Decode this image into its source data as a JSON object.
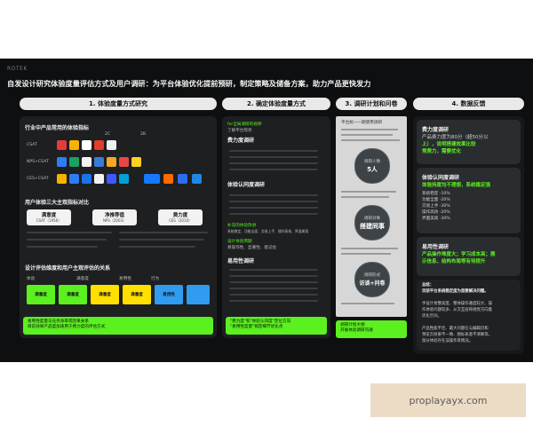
{
  "brand": "ROTEK",
  "title": "自发设计研究体验度量评估方式及用户调研：为平台体验优化提前预研，制定策略及储备方案，助力产品更快发力",
  "sections": [
    {
      "label": "1. 体验度量方式研究"
    },
    {
      "label": "2. 确定体验度量方式"
    },
    {
      "label": "3. 调研计划和问卷"
    },
    {
      "label": "4. 数据反馈"
    }
  ],
  "sec1": {
    "h1": "行业中产品常用的体验指标",
    "col_a": "2C",
    "col_b": "2B",
    "rows": [
      "CSAT",
      "NPS+CSAT",
      "CES+CSAT"
    ],
    "h2": "用户体验三大主观指标对比",
    "metrics": [
      {
        "name": "满意度",
        "sub": "CSAT（1956）"
      },
      {
        "name": "净推荐值",
        "sub": "NPS（2003）"
      },
      {
        "name": "费力度",
        "sub": "CES（2010）"
      }
    ],
    "h3": "设计评估维度和用户主观评估的关系",
    "dims": [
      "体验",
      "满意度",
      "易用性",
      "行为"
    ],
    "blocks": [
      "满意度",
      "满意度",
      "满意度",
      "满意度",
      "易用性"
    ],
    "note": "易用性度量与任务效率或因果关系\n目前效果产品度加速用于费力度的评估方式"
  },
  "sec2": {
    "line1": "for全局调研的规律",
    "line2": "了解平台现状",
    "h1": "费力度调研",
    "h2": "体验认同度调研",
    "line3": "补充的体验改进",
    "line4": "系统稳定、功能全面、交易上手、操作高效、界面美观",
    "line5": "设计体验周期",
    "line6": "易操作性、显著性、能记住",
    "h3": "易用性调研",
    "note": "\"费力度\"和\"体验认同度\"定位方向\n\"易用性度量\"锁定细节优化点"
  },
  "sec3": {
    "doc_title": "平台统一一期使用调研",
    "b1_a": "调研人数",
    "b1_b": "5人",
    "b2_a": "调研对象",
    "b2_b": "搭建同事",
    "b3_a": "调研形式",
    "b3_b": "访谈+问卷",
    "note": "调研计划大纲\n开展体验调研沟通"
  },
  "sec4": {
    "c1_title": "费力度调研",
    "c1_lines": [
      "产品费力度为80分（超50分以",
      "上），说明搭建效果比较",
      "常费力，需要优化"
    ],
    "c2_title": "体验认同度调研",
    "c2_highlight": "体验持度均不理想，系统稳定强",
    "c2_lines": [
      "系统稳定 -10%",
      "功能全面 -20%",
      "交易上手 -30%",
      "操作高效 -20%",
      "界面美观 -30%"
    ],
    "c3_title": "易用性调研",
    "c3_lines": [
      "产品操作难度大；学习成本高；展",
      "示信息、结构布局等有待提升"
    ],
    "c4_lines": [
      "总结：",
      "目前平台系统稳定度为首要解决问题。",
      "",
      "手设计易整高度、整体操作难度较大、操",
      "作体验问题较多、从交互层和视觉方向着",
      "优化空间。",
      "",
      "产品性能不佳、最大问题在与编辑页和",
      "预览页效果不一致、图标表意不清晰等。",
      "部分体验存在误操作等情况。"
    ]
  },
  "watermark": "proplayayx.com"
}
